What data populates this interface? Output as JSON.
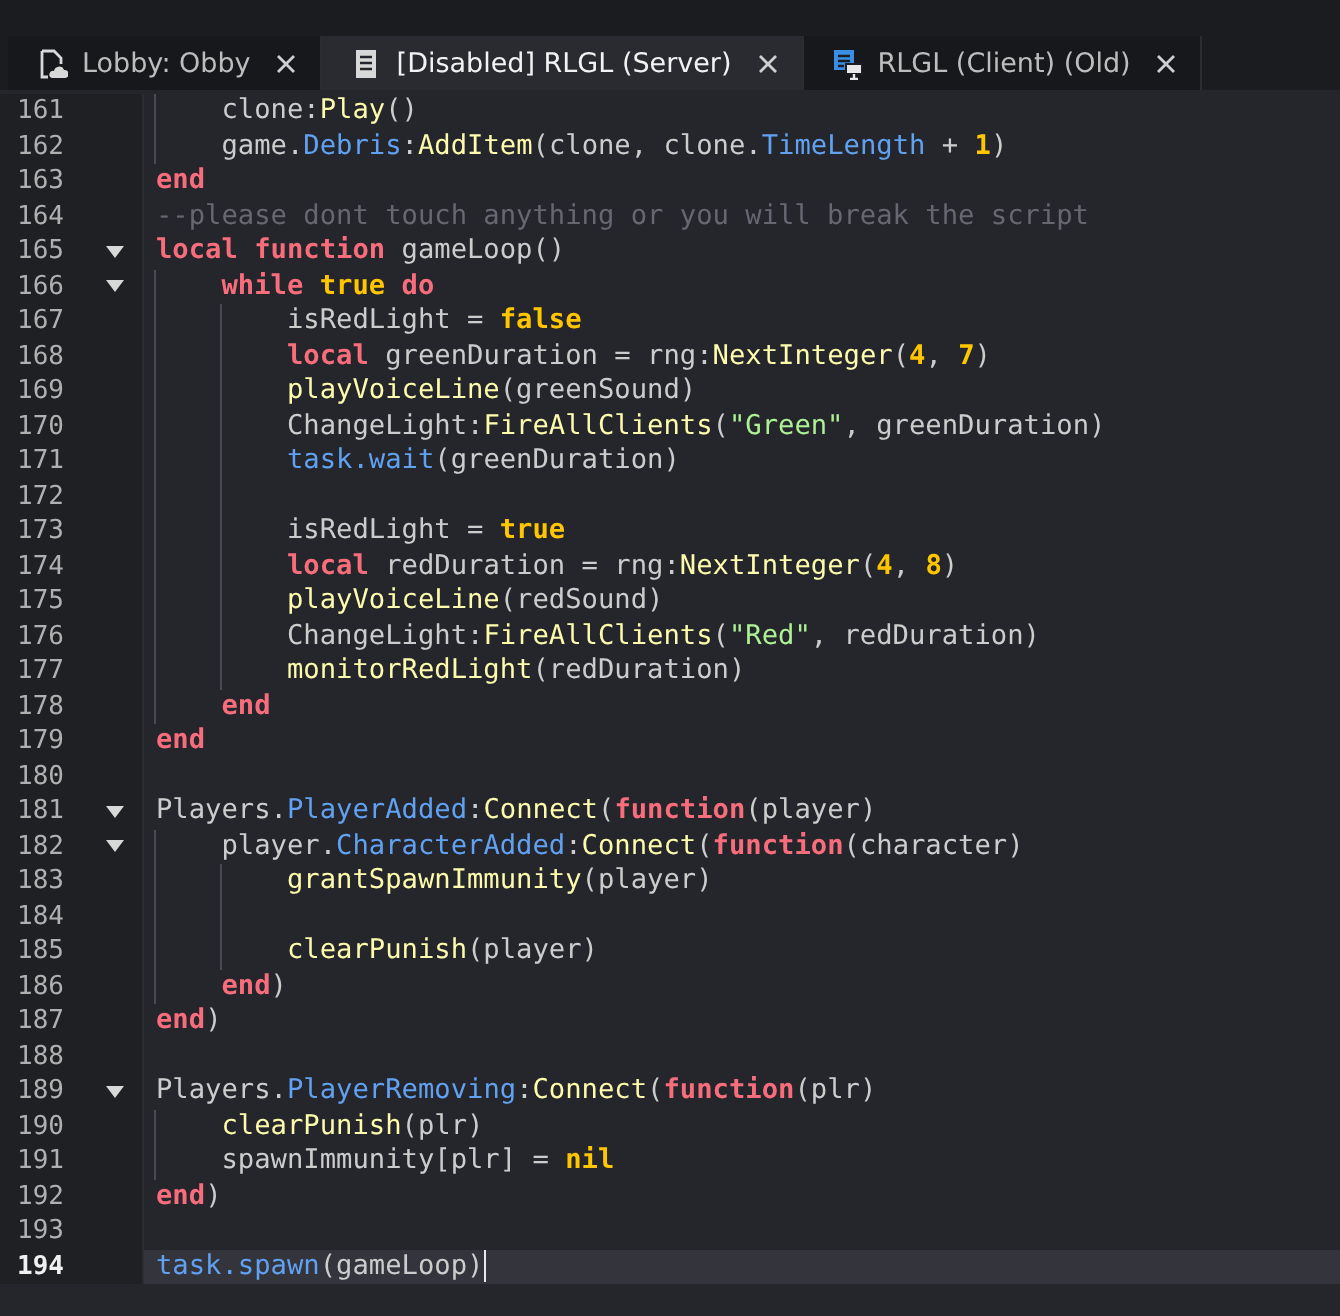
{
  "tabs": [
    {
      "kind": "place",
      "label": "Lobby: Obby",
      "selected": false
    },
    {
      "kind": "script",
      "label": "[Disabled] RLGL (Server)",
      "selected": true
    },
    {
      "kind": "client",
      "label": "RLGL (Client) (Old)",
      "selected": false
    }
  ],
  "editor": {
    "lines": [
      {
        "number": "161",
        "fold": false,
        "current": false,
        "tokens": [
          {
            "kind": "txt",
            "t": "    clone:"
          },
          {
            "kind": "fn",
            "t": "Play"
          },
          {
            "kind": "txt",
            "t": "()"
          }
        ]
      },
      {
        "number": "162",
        "fold": false,
        "current": false,
        "tokens": [
          {
            "kind": "txt",
            "t": "    game."
          },
          {
            "kind": "prop",
            "t": "Debris"
          },
          {
            "kind": "txt",
            "t": ":"
          },
          {
            "kind": "fn",
            "t": "AddItem"
          },
          {
            "kind": "txt",
            "t": "(clone, clone."
          },
          {
            "kind": "prop",
            "t": "TimeLength"
          },
          {
            "kind": "txt",
            "t": " + "
          },
          {
            "kind": "lit",
            "t": "1"
          },
          {
            "kind": "txt",
            "t": ")"
          }
        ]
      },
      {
        "number": "163",
        "fold": false,
        "current": false,
        "tokens": [
          {
            "kind": "kw",
            "t": "end"
          }
        ]
      },
      {
        "number": "164",
        "fold": false,
        "current": false,
        "tokens": [
          {
            "kind": "com",
            "t": "--please dont touch anything or you will break the script"
          }
        ]
      },
      {
        "number": "165",
        "fold": true,
        "current": false,
        "tokens": [
          {
            "kind": "kw",
            "t": "local function"
          },
          {
            "kind": "txt",
            "t": " gameLoop()"
          }
        ]
      },
      {
        "number": "166",
        "fold": true,
        "current": false,
        "tokens": [
          {
            "kind": "kw",
            "t": "    while"
          },
          {
            "kind": "lit",
            "t": " true"
          },
          {
            "kind": "kw",
            "t": " do"
          }
        ]
      },
      {
        "number": "167",
        "fold": false,
        "current": false,
        "tokens": [
          {
            "kind": "txt",
            "t": "        isRedLight = "
          },
          {
            "kind": "lit",
            "t": "false"
          }
        ]
      },
      {
        "number": "168",
        "fold": false,
        "current": false,
        "tokens": [
          {
            "kind": "kw",
            "t": "        local"
          },
          {
            "kind": "txt",
            "t": " greenDuration = rng:"
          },
          {
            "kind": "fn",
            "t": "NextInteger"
          },
          {
            "kind": "txt",
            "t": "("
          },
          {
            "kind": "lit",
            "t": "4"
          },
          {
            "kind": "txt",
            "t": ", "
          },
          {
            "kind": "lit",
            "t": "7"
          },
          {
            "kind": "txt",
            "t": ")"
          }
        ]
      },
      {
        "number": "169",
        "fold": false,
        "current": false,
        "tokens": [
          {
            "kind": "fn",
            "t": "        playVoiceLine"
          },
          {
            "kind": "txt",
            "t": "(greenSound)"
          }
        ]
      },
      {
        "number": "170",
        "fold": false,
        "current": false,
        "tokens": [
          {
            "kind": "txt",
            "t": "        ChangeLight:"
          },
          {
            "kind": "fn",
            "t": "FireAllClients"
          },
          {
            "kind": "txt",
            "t": "("
          },
          {
            "kind": "str",
            "t": "\"Green\""
          },
          {
            "kind": "txt",
            "t": ", greenDuration)"
          }
        ]
      },
      {
        "number": "171",
        "fold": false,
        "current": false,
        "tokens": [
          {
            "kind": "prop",
            "t": "        task.wait"
          },
          {
            "kind": "txt",
            "t": "(greenDuration)"
          }
        ]
      },
      {
        "number": "172",
        "fold": false,
        "current": false
      },
      {
        "number": "173",
        "fold": false,
        "current": false,
        "tokens": [
          {
            "kind": "txt",
            "t": "        isRedLight = "
          },
          {
            "kind": "lit",
            "t": "true"
          }
        ]
      },
      {
        "number": "174",
        "fold": false,
        "current": false,
        "tokens": [
          {
            "kind": "kw",
            "t": "        local"
          },
          {
            "kind": "txt",
            "t": " redDuration = rng:"
          },
          {
            "kind": "fn",
            "t": "NextInteger"
          },
          {
            "kind": "txt",
            "t": "("
          },
          {
            "kind": "lit",
            "t": "4"
          },
          {
            "kind": "txt",
            "t": ", "
          },
          {
            "kind": "lit",
            "t": "8"
          },
          {
            "kind": "txt",
            "t": ")"
          }
        ]
      },
      {
        "number": "175",
        "fold": false,
        "current": false,
        "tokens": [
          {
            "kind": "fn",
            "t": "        playVoiceLine"
          },
          {
            "kind": "txt",
            "t": "(redSound)"
          }
        ]
      },
      {
        "number": "176",
        "fold": false,
        "current": false,
        "tokens": [
          {
            "kind": "txt",
            "t": "        ChangeLight:"
          },
          {
            "kind": "fn",
            "t": "FireAllClients"
          },
          {
            "kind": "txt",
            "t": "("
          },
          {
            "kind": "str",
            "t": "\"Red\""
          },
          {
            "kind": "txt",
            "t": ", redDuration)"
          }
        ]
      },
      {
        "number": "177",
        "fold": false,
        "current": false,
        "tokens": [
          {
            "kind": "fn",
            "t": "        monitorRedLight"
          },
          {
            "kind": "txt",
            "t": "(redDuration)"
          }
        ]
      },
      {
        "number": "178",
        "fold": false,
        "current": false,
        "tokens": [
          {
            "kind": "kw",
            "t": "    end"
          }
        ]
      },
      {
        "number": "179",
        "fold": false,
        "current": false,
        "tokens": [
          {
            "kind": "kw",
            "t": "end"
          }
        ]
      },
      {
        "number": "180",
        "fold": false,
        "current": false
      },
      {
        "number": "181",
        "fold": true,
        "current": false,
        "tokens": [
          {
            "kind": "txt",
            "t": "Players."
          },
          {
            "kind": "prop",
            "t": "PlayerAdded"
          },
          {
            "kind": "txt",
            "t": ":"
          },
          {
            "kind": "fn",
            "t": "Connect"
          },
          {
            "kind": "txt",
            "t": "("
          },
          {
            "kind": "kw",
            "t": "function"
          },
          {
            "kind": "txt",
            "t": "(player)"
          }
        ]
      },
      {
        "number": "182",
        "fold": true,
        "current": false,
        "tokens": [
          {
            "kind": "txt",
            "t": "    player."
          },
          {
            "kind": "prop",
            "t": "CharacterAdded"
          },
          {
            "kind": "txt",
            "t": ":"
          },
          {
            "kind": "fn",
            "t": "Connect"
          },
          {
            "kind": "txt",
            "t": "("
          },
          {
            "kind": "kw",
            "t": "function"
          },
          {
            "kind": "txt",
            "t": "(character)"
          }
        ]
      },
      {
        "number": "183",
        "fold": false,
        "current": false,
        "tokens": [
          {
            "kind": "fn",
            "t": "        grantSpawnImmunity"
          },
          {
            "kind": "txt",
            "t": "(player)"
          }
        ]
      },
      {
        "number": "184",
        "fold": false,
        "current": false
      },
      {
        "number": "185",
        "fold": false,
        "current": false,
        "tokens": [
          {
            "kind": "fn",
            "t": "        clearPunish"
          },
          {
            "kind": "txt",
            "t": "(player)"
          }
        ]
      },
      {
        "number": "186",
        "fold": false,
        "current": false,
        "tokens": [
          {
            "kind": "kw",
            "t": "    end"
          },
          {
            "kind": "txt",
            "t": ")"
          }
        ]
      },
      {
        "number": "187",
        "fold": false,
        "current": false,
        "tokens": [
          {
            "kind": "kw",
            "t": "end"
          },
          {
            "kind": "txt",
            "t": ")"
          }
        ]
      },
      {
        "number": "188",
        "fold": false,
        "current": false
      },
      {
        "number": "189",
        "fold": true,
        "current": false,
        "tokens": [
          {
            "kind": "txt",
            "t": "Players."
          },
          {
            "kind": "prop",
            "t": "PlayerRemoving"
          },
          {
            "kind": "txt",
            "t": ":"
          },
          {
            "kind": "fn",
            "t": "Connect"
          },
          {
            "kind": "txt",
            "t": "("
          },
          {
            "kind": "kw",
            "t": "function"
          },
          {
            "kind": "txt",
            "t": "(plr)"
          }
        ]
      },
      {
        "number": "190",
        "fold": false,
        "current": false,
        "tokens": [
          {
            "kind": "fn",
            "t": "    clearPunish"
          },
          {
            "kind": "txt",
            "t": "(plr)"
          }
        ]
      },
      {
        "number": "191",
        "fold": false,
        "current": false,
        "tokens": [
          {
            "kind": "txt",
            "t": "    spawnImmunity[plr] = "
          },
          {
            "kind": "lit",
            "t": "nil"
          }
        ]
      },
      {
        "number": "192",
        "fold": false,
        "current": false,
        "tokens": [
          {
            "kind": "kw",
            "t": "end"
          },
          {
            "kind": "txt",
            "t": ")"
          }
        ]
      },
      {
        "number": "193",
        "fold": false,
        "current": false
      },
      {
        "number": "194",
        "fold": false,
        "current": true,
        "tokens": [
          {
            "kind": "prop",
            "t": "task.spawn"
          },
          {
            "kind": "txt",
            "t": "(gameLoop)"
          }
        ]
      }
    ]
  }
}
